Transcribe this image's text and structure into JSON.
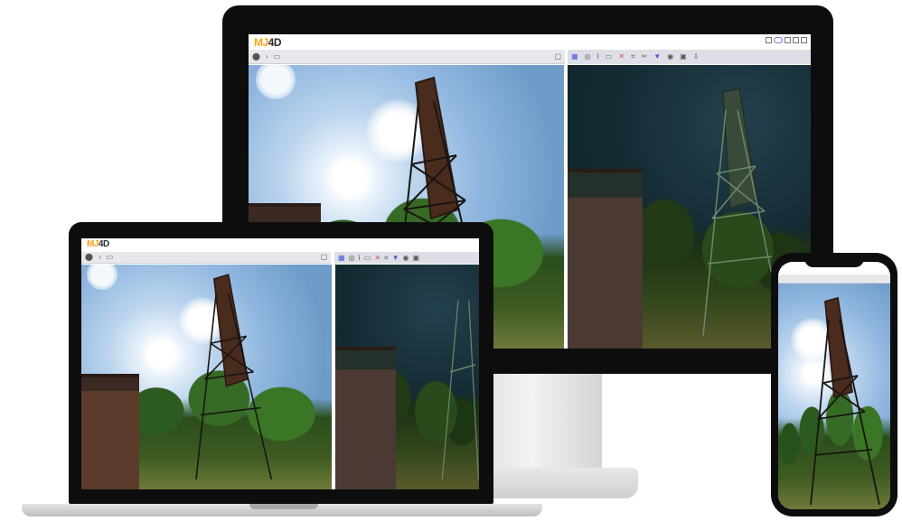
{
  "app": {
    "logo_part1": "MJ",
    "logo_part2": "4D"
  },
  "devices": [
    "monitor",
    "laptop",
    "phone"
  ],
  "toolbar": {
    "left_icons": [
      "pin-icon",
      "arrow-icon",
      "image-icon"
    ],
    "right_icons": [
      "grid-icon",
      "target-icon",
      "info-icon",
      "ruler-icon",
      "close-icon",
      "crop-icon",
      "scissors-icon",
      "drop-icon",
      "eye-icon",
      "layers-icon",
      "download-icon"
    ]
  },
  "colors": {
    "logo_accent": "#f7a21b",
    "logo_dark": "#2e2e2e",
    "toolbar_bg": "#e7e8ec",
    "device_frame": "#0d0d0d"
  },
  "panels": {
    "left": "original-photo",
    "right": "processed-photo"
  }
}
